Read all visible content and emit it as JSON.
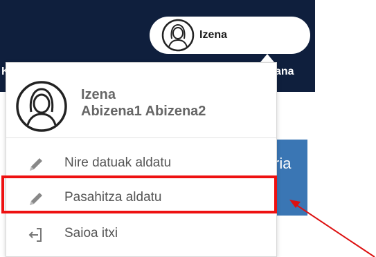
{
  "header": {
    "user_name": "Izena",
    "left_fragment": "K",
    "right_fragment": "ana"
  },
  "blue_button": {
    "fragment": "ria"
  },
  "profile": {
    "name": "Izena",
    "surnames": "Abizena1 Abizena2"
  },
  "menu": {
    "items": [
      {
        "label": "Nire datuak aldatu",
        "icon": "pencil-icon"
      },
      {
        "label": "Pasahitza aldatu",
        "icon": "pencil-icon"
      },
      {
        "label": "Saioa itxi",
        "icon": "logout-icon"
      }
    ]
  },
  "colors": {
    "header_bg": "#0f1f3d",
    "button_blue": "#3a76b4",
    "highlight_red": "#ee1111",
    "text_gray": "#555555"
  }
}
